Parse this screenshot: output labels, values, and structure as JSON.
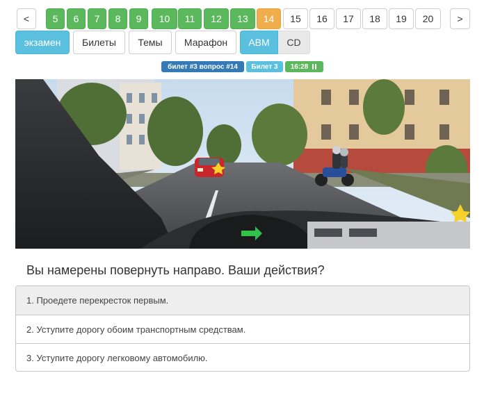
{
  "pager": {
    "prev": "<",
    "next": ">",
    "pages": [
      "5",
      "6",
      "7",
      "8",
      "9",
      "10",
      "11",
      "12",
      "13",
      "14",
      "15",
      "16",
      "17",
      "18",
      "19",
      "20"
    ]
  },
  "modes": {
    "exam": "экзамен",
    "tickets": "Билеты",
    "topics": "Темы",
    "marathon": "Марафон",
    "abm": "ABM",
    "cd": "CD"
  },
  "labels": {
    "ticket_question": "билет #3 вопрос #14",
    "ticket": "Билет 3",
    "timer": "16:28",
    "pause_icon": "pause-icon"
  },
  "colors": {
    "correct": "#5cb85c",
    "current": "#f0ad4e",
    "info": "#5bc0de",
    "primary": "#337ab7"
  },
  "question": "Вы намерены повернуть направо. Ваши действия?",
  "answers": [
    "1. Проедете перекресток первым.",
    "2. Уступите дорогу обоим транспортным средствам.",
    "3. Уступите дорогу легковому автомобилю."
  ]
}
